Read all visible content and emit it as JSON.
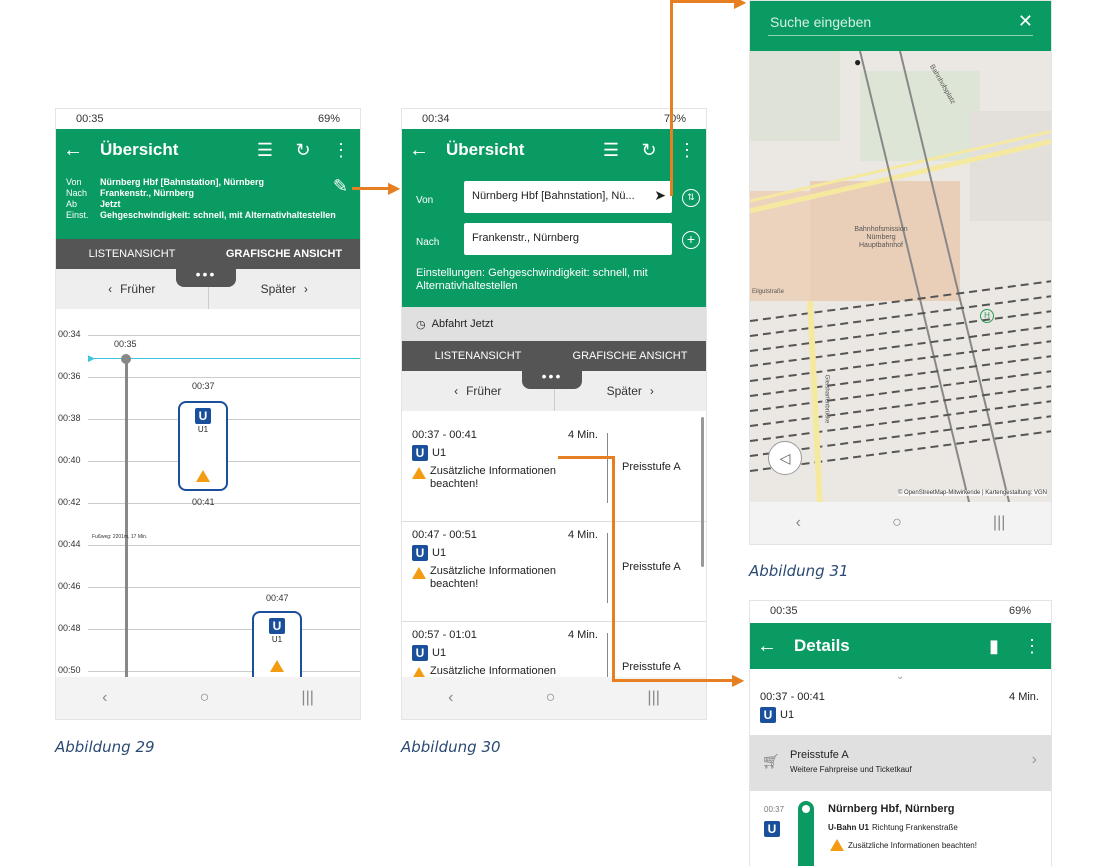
{
  "screen29": {
    "status_time": "00:35",
    "status_right": "69%",
    "title": "Übersicht",
    "von_label": "Von",
    "von_value": "Nürnberg Hbf [Bahnstation], Nürnberg",
    "nach_label": "Nach",
    "nach_value": "Frankenstr., Nürnberg",
    "ab_label": "Ab",
    "ab_value": "Jetzt",
    "einst_label": "Einst.",
    "einst_value": "Gehgeschwindigkeit: schnell, mit Alternativhaltestellen",
    "tab_list": "LISTENANSICHT",
    "tab_graph": "GRAFISCHE ANSICHT",
    "earlier": "Früher",
    "later": "Später",
    "ticks": [
      "00:34",
      "00:36",
      "00:38",
      "00:40",
      "00:42",
      "00:44",
      "00:46",
      "00:48",
      "00:50"
    ],
    "now_label": "00:35",
    "trip1_dep": "00:37",
    "trip1_arr": "00:41",
    "trip_line": "U1",
    "walk_label": "Fußweg: 2201m, 17 Min.",
    "trip2_dep": "00:47",
    "caption": "Abbildung 29"
  },
  "screen30": {
    "status_time": "00:34",
    "status_right": "70%",
    "title": "Übersicht",
    "von_label": "Von",
    "von_value": "Nürnberg Hbf [Bahnstation], Nü...",
    "nach_label": "Nach",
    "nach_value": "Frankenstr., Nürnberg",
    "settings": "Einstellungen: Gehgeschwindigkeit: schnell, mit Alternativhaltestellen",
    "departure": "Abfahrt Jetzt",
    "tab_list": "LISTENANSICHT",
    "tab_graph": "GRAFISCHE ANSICHT",
    "earlier": "Früher",
    "later": "Später",
    "trips": [
      {
        "time": "00:37 - 00:41",
        "dur": "4 Min.",
        "line": "U1",
        "info": "Zusätzliche Informationen beachten!",
        "price": "Preisstufe A"
      },
      {
        "time": "00:47 - 00:51",
        "dur": "4 Min.",
        "line": "U1",
        "info": "Zusätzliche Informationen beachten!",
        "price": "Preisstufe A"
      },
      {
        "time": "00:57 - 01:01",
        "dur": "4 Min.",
        "line": "U1",
        "info": "Zusätzliche Informationen beachten!",
        "price": "Preisstufe A"
      }
    ],
    "caption": "Abbildung 30"
  },
  "screen31": {
    "search_placeholder": "Suche eingeben",
    "map_labels": {
      "mission": "Bahnhofsmission Nürnberg Hauptbahnhof",
      "street1": "Bahnhofsplatz",
      "street2": "Eilgutstraße",
      "street3": "Gleisharfenbrücke"
    },
    "attribution": "© OpenStreetMap-Mitwirkende | Kartengestaltung: VGN",
    "caption": "Abbildung 31"
  },
  "screen32": {
    "status_time": "00:35",
    "status_right": "69%",
    "title": "Details",
    "time": "00:37 - 00:41",
    "dur": "4 Min.",
    "line": "U1",
    "price_title": "Preisstufe A",
    "price_sub": "Weitere Fahrpreise und Ticketkauf",
    "stop_time": "00:37",
    "stop_name": "Nürnberg Hbf, Nürnberg",
    "stop_line": "U-Bahn U1",
    "stop_dir": "Richtung Frankenstraße",
    "stop_info": "Zusätzliche Informationen beachten!"
  },
  "colors": {
    "green": "#0a9b63",
    "arrow": "#e67e22",
    "ubahn": "#1a4f9c",
    "warning": "#f39c12"
  }
}
